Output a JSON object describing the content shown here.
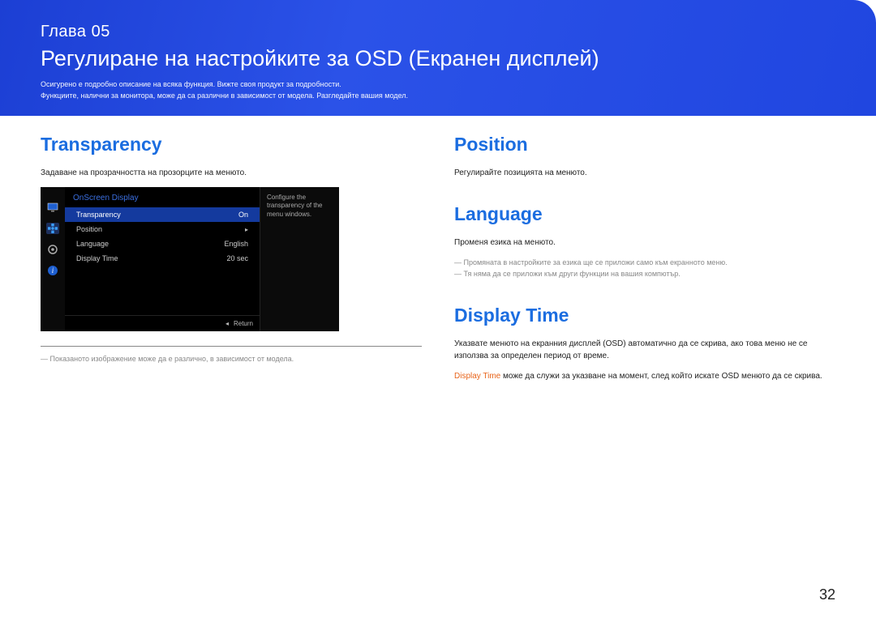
{
  "header": {
    "chapter": "Глава 05",
    "title": "Регулиране на настройките за OSD (Екранен дисплей)",
    "note1": "Осигурено е подробно описание на всяка функция. Вижте своя продукт за подробности.",
    "note2": "Функциите, налични за монитора, може да са различни в зависимост от модела. Разгледайте вашия модел."
  },
  "left": {
    "transparency": {
      "heading": "Transparency",
      "text": "Задаване на прозрачността на прозорците на менюто."
    },
    "osd": {
      "title": "OnScreen Display",
      "rows": [
        {
          "label": "Transparency",
          "value": "On",
          "selected": true
        },
        {
          "label": "Position",
          "value": "▸",
          "selected": false
        },
        {
          "label": "Language",
          "value": "English",
          "selected": false
        },
        {
          "label": "Display Time",
          "value": "20 sec",
          "selected": false
        }
      ],
      "info": "Configure the transparency of the menu windows.",
      "return": "Return",
      "return_icon": "◂"
    },
    "caption": "Показаното изображение може да е различно, в зависимост от модела."
  },
  "right": {
    "position": {
      "heading": "Position",
      "text": "Регулирайте позицията на менюто."
    },
    "language": {
      "heading": "Language",
      "text": "Променя езика на менюто.",
      "note1": "Промяната в настройките за езика ще се приложи само към екранното меню.",
      "note2": "Тя няма да се приложи към други функции на вашия компютър."
    },
    "displayTime": {
      "heading": "Display Time",
      "text": "Указвате менюто на екранния дисплей (OSD) автоматично да се скрива, ако това меню не се използва за определен период от време.",
      "highlight_label": "Display Time",
      "text2": " може да служи за указване на момент, след който искате OSD менюто да се скрива."
    }
  },
  "page": "32"
}
